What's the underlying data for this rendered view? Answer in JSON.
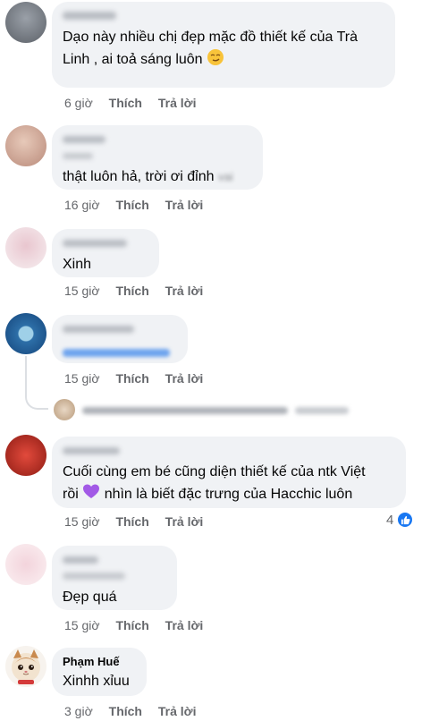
{
  "actions": {
    "like": "Thích",
    "reply": "Trả lời"
  },
  "comments": [
    {
      "author": "",
      "text_line1": "Dạo này nhiều chị đẹp mặc đồ thiết kế của Trà",
      "text_line2": "Linh , ai toả sáng luôn",
      "emoji": "smirking-face",
      "time": "6 giờ"
    },
    {
      "author": "",
      "text": "thật luôn hả, trời ơi đỉnh",
      "time": "16 giờ"
    },
    {
      "author": "",
      "text": "Xinh",
      "time": "15 giờ"
    },
    {
      "author": "",
      "text": "",
      "time": "15 giờ"
    },
    {
      "author": "",
      "text_line1": "Cuối cùng em bé cũng diện thiết kế của ntk Việt",
      "text_line2_a": "rồi",
      "text_line2_b": "nhìn là biết đặc trưng của Hacchic luôn",
      "emoji": "purple-heart",
      "time": "15 giờ",
      "reaction_count": "4"
    },
    {
      "author": "",
      "text": "Đẹp quá",
      "time": "15 giờ"
    },
    {
      "author": "Phạm Huế",
      "text": "Xinhh xỉuu",
      "time": "3 giờ"
    }
  ],
  "colors": {
    "bubble": "#f0f2f5",
    "meta": "#65676b",
    "like_blue": "#1877f2",
    "purple_heart": "#a259e6"
  }
}
